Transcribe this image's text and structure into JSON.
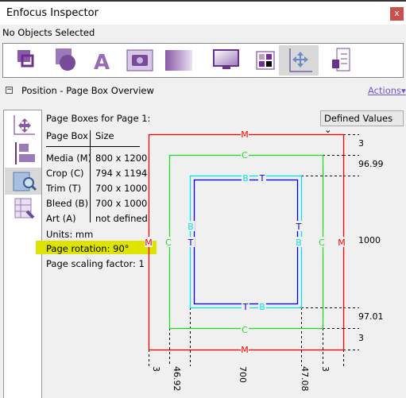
{
  "window": {
    "title": "Enfocus Inspector",
    "close_label": "x"
  },
  "selection_status": "No Objects Selected",
  "toolbar": {
    "tools": [
      "object-icon",
      "shape-icon",
      "text-icon",
      "image-icon",
      "transparency-icon",
      "display-icon",
      "color-icon",
      "position-icon",
      "document-info-icon"
    ],
    "active": "position-icon"
  },
  "section": {
    "toggle": "−",
    "title": "Position - Page Box Overview",
    "actions_label": "Actions▾"
  },
  "sidebar": {
    "items": [
      "position-icon",
      "align-icon",
      "page-box-inspect-icon",
      "page-box-edit-icon"
    ],
    "active": "page-box-inspect-icon"
  },
  "dropdown": {
    "value": "Defined Values ⌄"
  },
  "info": {
    "heading": "Page Boxes for Page 1:",
    "columns": [
      "Page Box",
      "Size"
    ],
    "rows": [
      [
        "Media (M)",
        "800 x 1200"
      ],
      [
        "Crop (C)",
        "794 x 1194"
      ],
      [
        "Trim (T)",
        "700 x 1000"
      ],
      [
        "Bleed (B)",
        "700 x 1000"
      ],
      [
        "Art (A)",
        "not defined"
      ]
    ],
    "units": "Units: mm",
    "rotation": "Page rotation: 90°",
    "scaling": "Page scaling factor: 1"
  },
  "diagram": {
    "colors": {
      "media": "#ff0000",
      "crop": "#22dd22",
      "bleed": "#00e5ee",
      "trim": "#0000ff",
      "highlight": "#dde400"
    },
    "labels": {
      "media": "M",
      "crop": "C",
      "trim": "T",
      "bleed": "B"
    },
    "right_dims": [
      "3",
      "96.99",
      "1000",
      "97.01",
      "3"
    ],
    "bottom_dims": [
      "3",
      "46.92",
      "700",
      "47.08",
      "3"
    ]
  }
}
